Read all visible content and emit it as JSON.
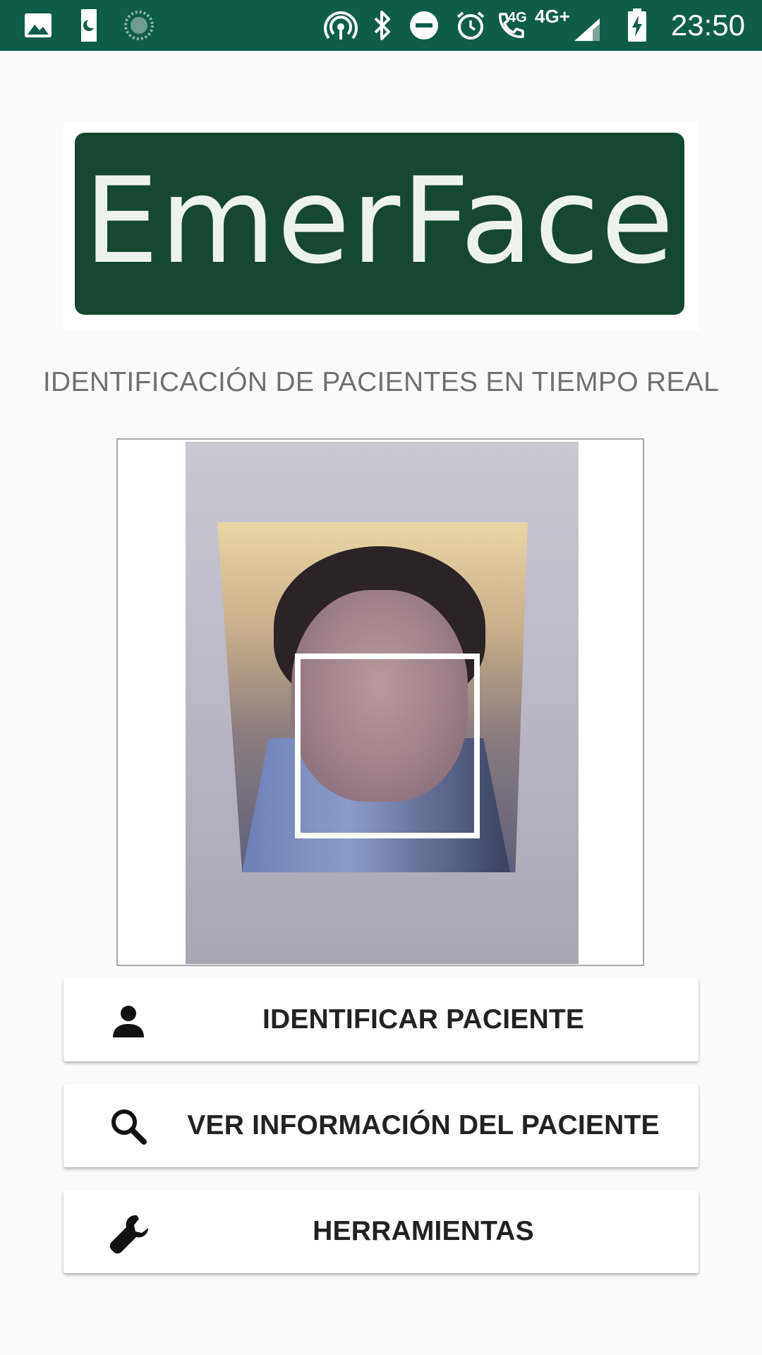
{
  "status_bar": {
    "time": "23:50",
    "net_4g_small": "4G",
    "net_4g_plus": "4G+",
    "icons": [
      "gallery-icon",
      "sim-moon-icon",
      "loading-icon",
      "hotspot-icon",
      "bluetooth-icon",
      "do-not-disturb-icon",
      "alarm-icon",
      "wifi-call-icon",
      "signal-icon",
      "battery-charging-icon"
    ],
    "background_color": "#0d5d49"
  },
  "logo": {
    "text": "EmerFace",
    "background_color": "#164731"
  },
  "subtitle": "IDENTIFICACIÓN DE PACIENTES EN TIEMPO REAL",
  "camera_preview": {
    "face_detection_box": "white-square"
  },
  "menu": {
    "identify": {
      "label": "IDENTIFICAR PACIENTE",
      "icon": "person-icon"
    },
    "info": {
      "label": "VER INFORMACIÓN DEL PACIENTE",
      "icon": "search-icon"
    },
    "tools": {
      "label": "HERRAMIENTAS",
      "icon": "wrench-icon"
    }
  }
}
